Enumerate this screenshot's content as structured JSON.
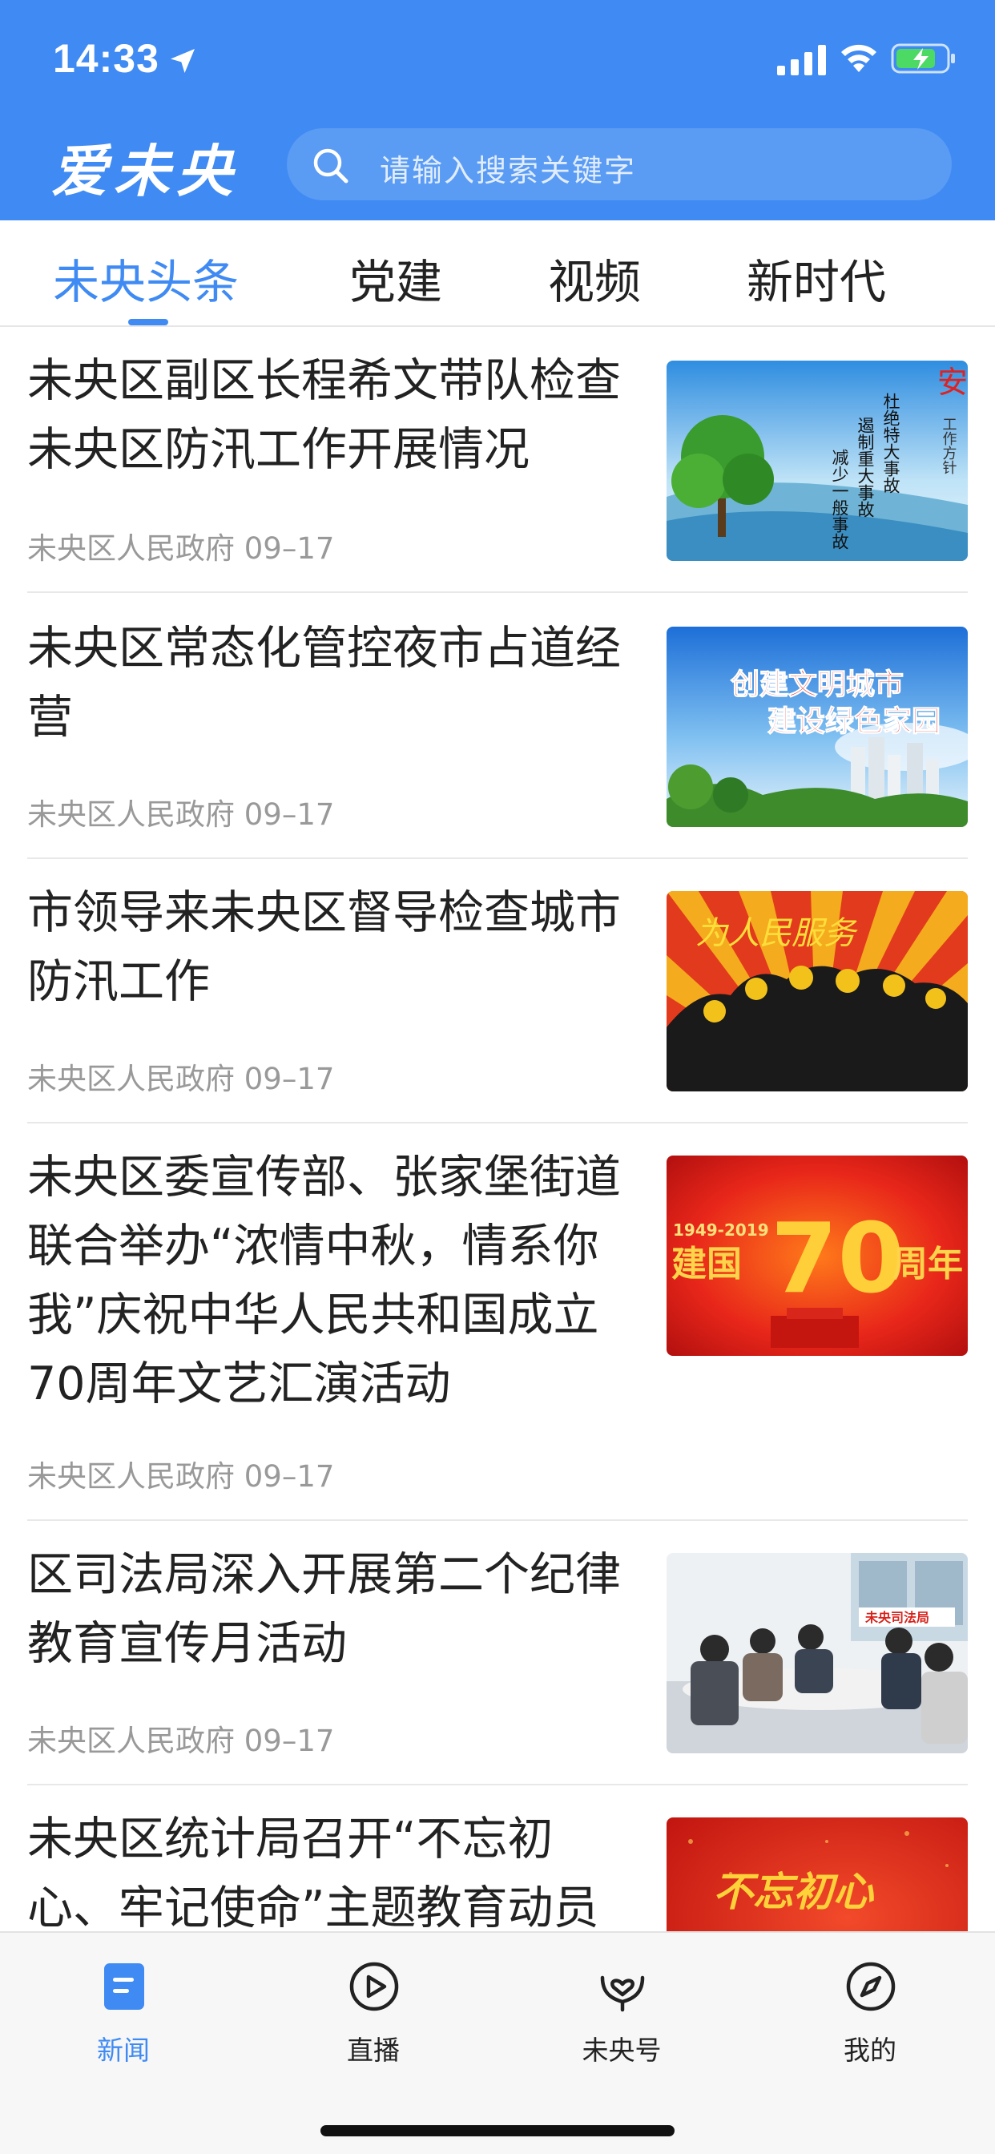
{
  "status_bar": {
    "time": "14:33"
  },
  "header": {
    "logo": "爱未央",
    "search_placeholder": "请输入搜索关键字"
  },
  "tabs": [
    {
      "label": "未央头条",
      "active": true
    },
    {
      "label": "党建",
      "active": false
    },
    {
      "label": "视频",
      "active": false
    },
    {
      "label": "新时代",
      "active": false
    }
  ],
  "articles": [
    {
      "title": "未央区副区长程希文带队检查未央区防汛工作开展情况",
      "source": "未央区人民政府 09–17",
      "image_text": [
        "杜绝特大事故",
        "遏制重大事故",
        "减少一般事故",
        "安",
        "工作方针"
      ]
    },
    {
      "title": "未央区常态化管控夜市占道经营",
      "source": "未央区人民政府 09–17",
      "image_text": [
        "创建文明城市",
        "建设绿色家园"
      ]
    },
    {
      "title": "市领导来未央区督导检查城市防汛工作",
      "source": "未央区人民政府 09–17",
      "image_text": [
        "为人民服务"
      ]
    },
    {
      "title": "未央区委宣传部、张家堡街道联合举办“浓情中秋，情系你我”庆祝中华人民共和国成立70周年文艺汇演活动",
      "source": "未央区人民政府 09–17",
      "image_text": [
        "1949-2019",
        "建国",
        "70",
        "周年"
      ]
    },
    {
      "title": "区司法局深入开展第二个纪律教育宣传月活动",
      "source": "未央区人民政府 09–17",
      "image_text": [
        "未央司法局"
      ]
    },
    {
      "title": "未央区统计局召开“不忘初心、牢记使命”主题教育动员",
      "source": "",
      "image_text": [
        "不忘初心"
      ]
    }
  ],
  "bottom_nav": [
    {
      "label": "新闻",
      "icon": "news-icon",
      "active": true
    },
    {
      "label": "直播",
      "icon": "play-circle-icon",
      "active": false
    },
    {
      "label": "未央号",
      "icon": "heart-hands-icon",
      "active": false
    },
    {
      "label": "我的",
      "icon": "compass-icon",
      "active": false
    }
  ],
  "colors": {
    "primary": "#3F8BF3",
    "text": "#222222",
    "meta": "#999999"
  }
}
